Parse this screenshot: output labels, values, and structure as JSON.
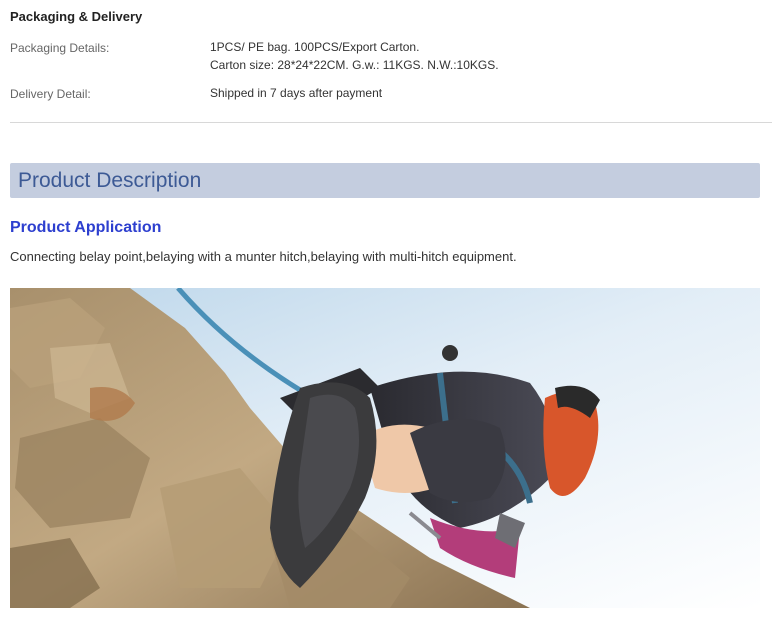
{
  "packaging": {
    "title": "Packaging & Delivery",
    "details_label": "Packaging Details:",
    "details_line1": "1PCS/ PE bag. 100PCS/Export Carton.",
    "details_line2": "Carton size: 28*24*22CM. G.w.: 11KGS. N.W.:10KGS.",
    "delivery_label": "Delivery Detail:",
    "delivery_value": "Shipped in 7 days after payment"
  },
  "description": {
    "header": "Product Description",
    "application_title": "Product Application",
    "application_text": "Connecting belay point,belaying with a munter hitch,belaying with multi-hitch equipment."
  },
  "colors": {
    "header_bar": "#c4cddf",
    "header_text": "#3d5a95",
    "application_title": "#2d3fcf"
  }
}
